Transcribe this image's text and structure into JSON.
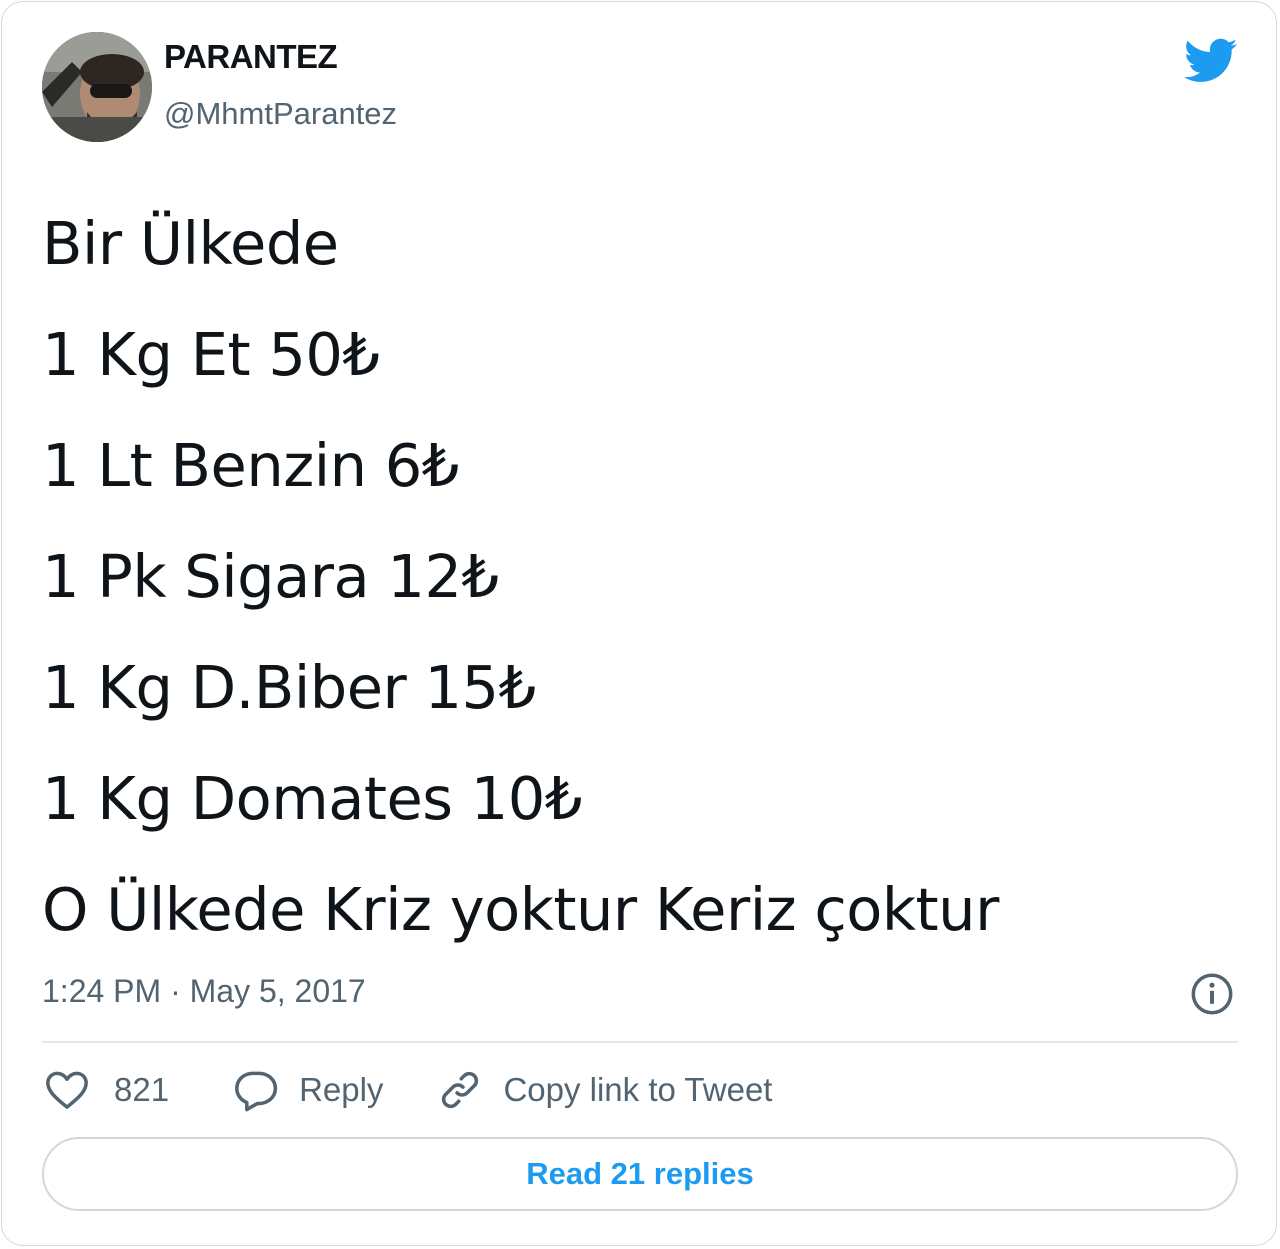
{
  "author": {
    "name": "PARANTEZ",
    "handle": "@MhmtParantez"
  },
  "tweet": {
    "lines": [
      "Bir Ülkede",
      "1 Kg Et 50₺",
      "1 Lt Benzin 6₺",
      "1 Pk Sigara 12₺",
      "1 Kg D.Biber 15₺",
      "1 Kg Domates 10₺",
      "O Ülkede Kriz yoktur Keriz çoktur"
    ],
    "timestamp": "1:24 PM · May 5, 2017"
  },
  "actions": {
    "like_count": "821",
    "reply_label": "Reply",
    "copy_link_label": "Copy link to Tweet"
  },
  "read_replies_label": "Read 21 replies",
  "icons": {
    "brand": "twitter-bird-icon",
    "info": "info-icon",
    "like": "heart-icon",
    "reply": "speech-bubble-icon",
    "copy": "link-icon"
  },
  "colors": {
    "brand_blue": "#1d9bf0",
    "text_primary": "#0f1419",
    "text_secondary": "#536471",
    "border": "#cfd9de"
  }
}
